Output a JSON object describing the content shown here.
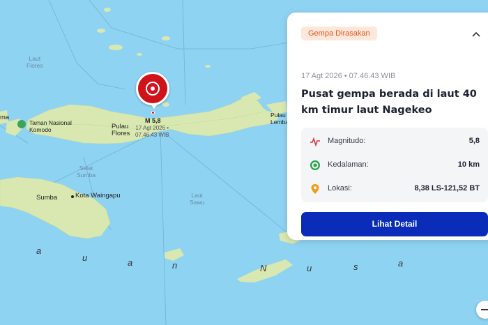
{
  "map": {
    "seas": {
      "laut_flores": "Laut\nFlores",
      "selat_sumba": "Selat\nSumba",
      "laut_sawu": "Laut\nSawu"
    },
    "places": {
      "pulau_flores": "Pulau\nFlores",
      "taman_nasional_komodo": "Taman Nasional\nKomodo",
      "sumba": "Sumba",
      "kota_waingapu": "Kota Waingapu",
      "pulau_lembata_partial": "Pulau\nLemba",
      "left_partial": "ma"
    },
    "ocean_letters": [
      "a",
      "u",
      "a",
      "n",
      "N",
      "u",
      "s",
      "a"
    ],
    "marker": {
      "magnitude_label": "M 5,8",
      "time_label": "17 Agt 2026 •\n07.46.43 WIB"
    },
    "colors": {
      "sea": "#8fd3f2",
      "land": "#d9e8b0",
      "marker": "#d0121b"
    }
  },
  "card": {
    "badge": "Gempa Dirasakan",
    "datetime": "17 Agt 2026 • 07.46.43 WIB",
    "headline": "Pusat gempa berada di laut 40 km timur laut Nagekeo",
    "rows": [
      {
        "icon": "pulse-icon",
        "label": "Magnitudo:",
        "value": "5,8"
      },
      {
        "icon": "target-icon",
        "label": "Kedalaman:",
        "value": "10 km"
      },
      {
        "icon": "location-pin-icon",
        "label": "Lokasi:",
        "value": "8,38 LS-121,52 BT"
      }
    ],
    "button": "Lihat Detail",
    "colors": {
      "accent": "#0a2cb8",
      "badge_bg": "#fde8db",
      "badge_text": "#e0561b"
    }
  }
}
